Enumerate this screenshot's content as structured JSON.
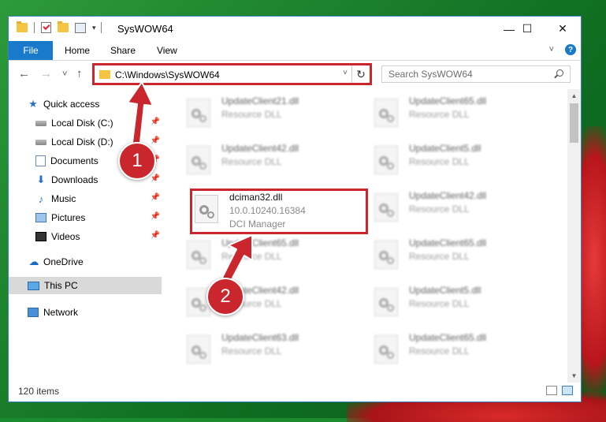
{
  "window": {
    "title": "SysWOW64",
    "minimize": "—",
    "maximize": "☐",
    "close": "✕"
  },
  "ribbon": {
    "tabs": [
      "File",
      "Home",
      "Share",
      "View"
    ],
    "help": "?"
  },
  "nav": {
    "address": "C:\\Windows\\SysWOW64",
    "search_placeholder": "Search SysWOW64",
    "back": "←",
    "forward": "→",
    "recent": "˅",
    "up": "↑",
    "refresh": "↻"
  },
  "sidebar": {
    "items": [
      {
        "label": "Quick access"
      },
      {
        "label": "Local Disk (C:)"
      },
      {
        "label": "Local Disk (D:)"
      },
      {
        "label": "Documents"
      },
      {
        "label": "Downloads"
      },
      {
        "label": "Music"
      },
      {
        "label": "Pictures"
      },
      {
        "label": "Videos"
      },
      {
        "label": "OneDrive"
      },
      {
        "label": "This PC"
      },
      {
        "label": "Network"
      }
    ]
  },
  "files": {
    "items": [
      {
        "name": "UpdateClient21.dll",
        "desc": "Resource DLL"
      },
      {
        "name": "UpdateClient65.dll",
        "desc": "Resource DLL"
      },
      {
        "name": "UpdateClient42.dll",
        "desc": "Resource DLL"
      },
      {
        "name": "UpdateClient5.dll",
        "desc": "Resource DLL"
      },
      {
        "name": "dciman32.dll",
        "version": "10.0.10240.16384",
        "desc": "DCI Manager"
      },
      {
        "name": "UpdateClient42.dll",
        "desc": "Resource DLL"
      },
      {
        "name": "UpdateClient65.dll",
        "desc": "Resource DLL"
      },
      {
        "name": "UpdateClient65.dll",
        "desc": "Resource DLL"
      },
      {
        "name": "UpdateClient42.dll",
        "desc": "Resource DLL"
      },
      {
        "name": "UpdateClient5.dll",
        "desc": "Resource DLL"
      },
      {
        "name": "UpdateClient63.dll",
        "desc": "Resource DLL"
      },
      {
        "name": "UpdateClient65.dll",
        "desc": "Resource DLL"
      }
    ]
  },
  "status": {
    "count": "120 items"
  },
  "annotations": {
    "marker1": "1",
    "marker2": "2"
  },
  "colors": {
    "accent": "#1979ca",
    "annotation_red": "#c9262e"
  }
}
